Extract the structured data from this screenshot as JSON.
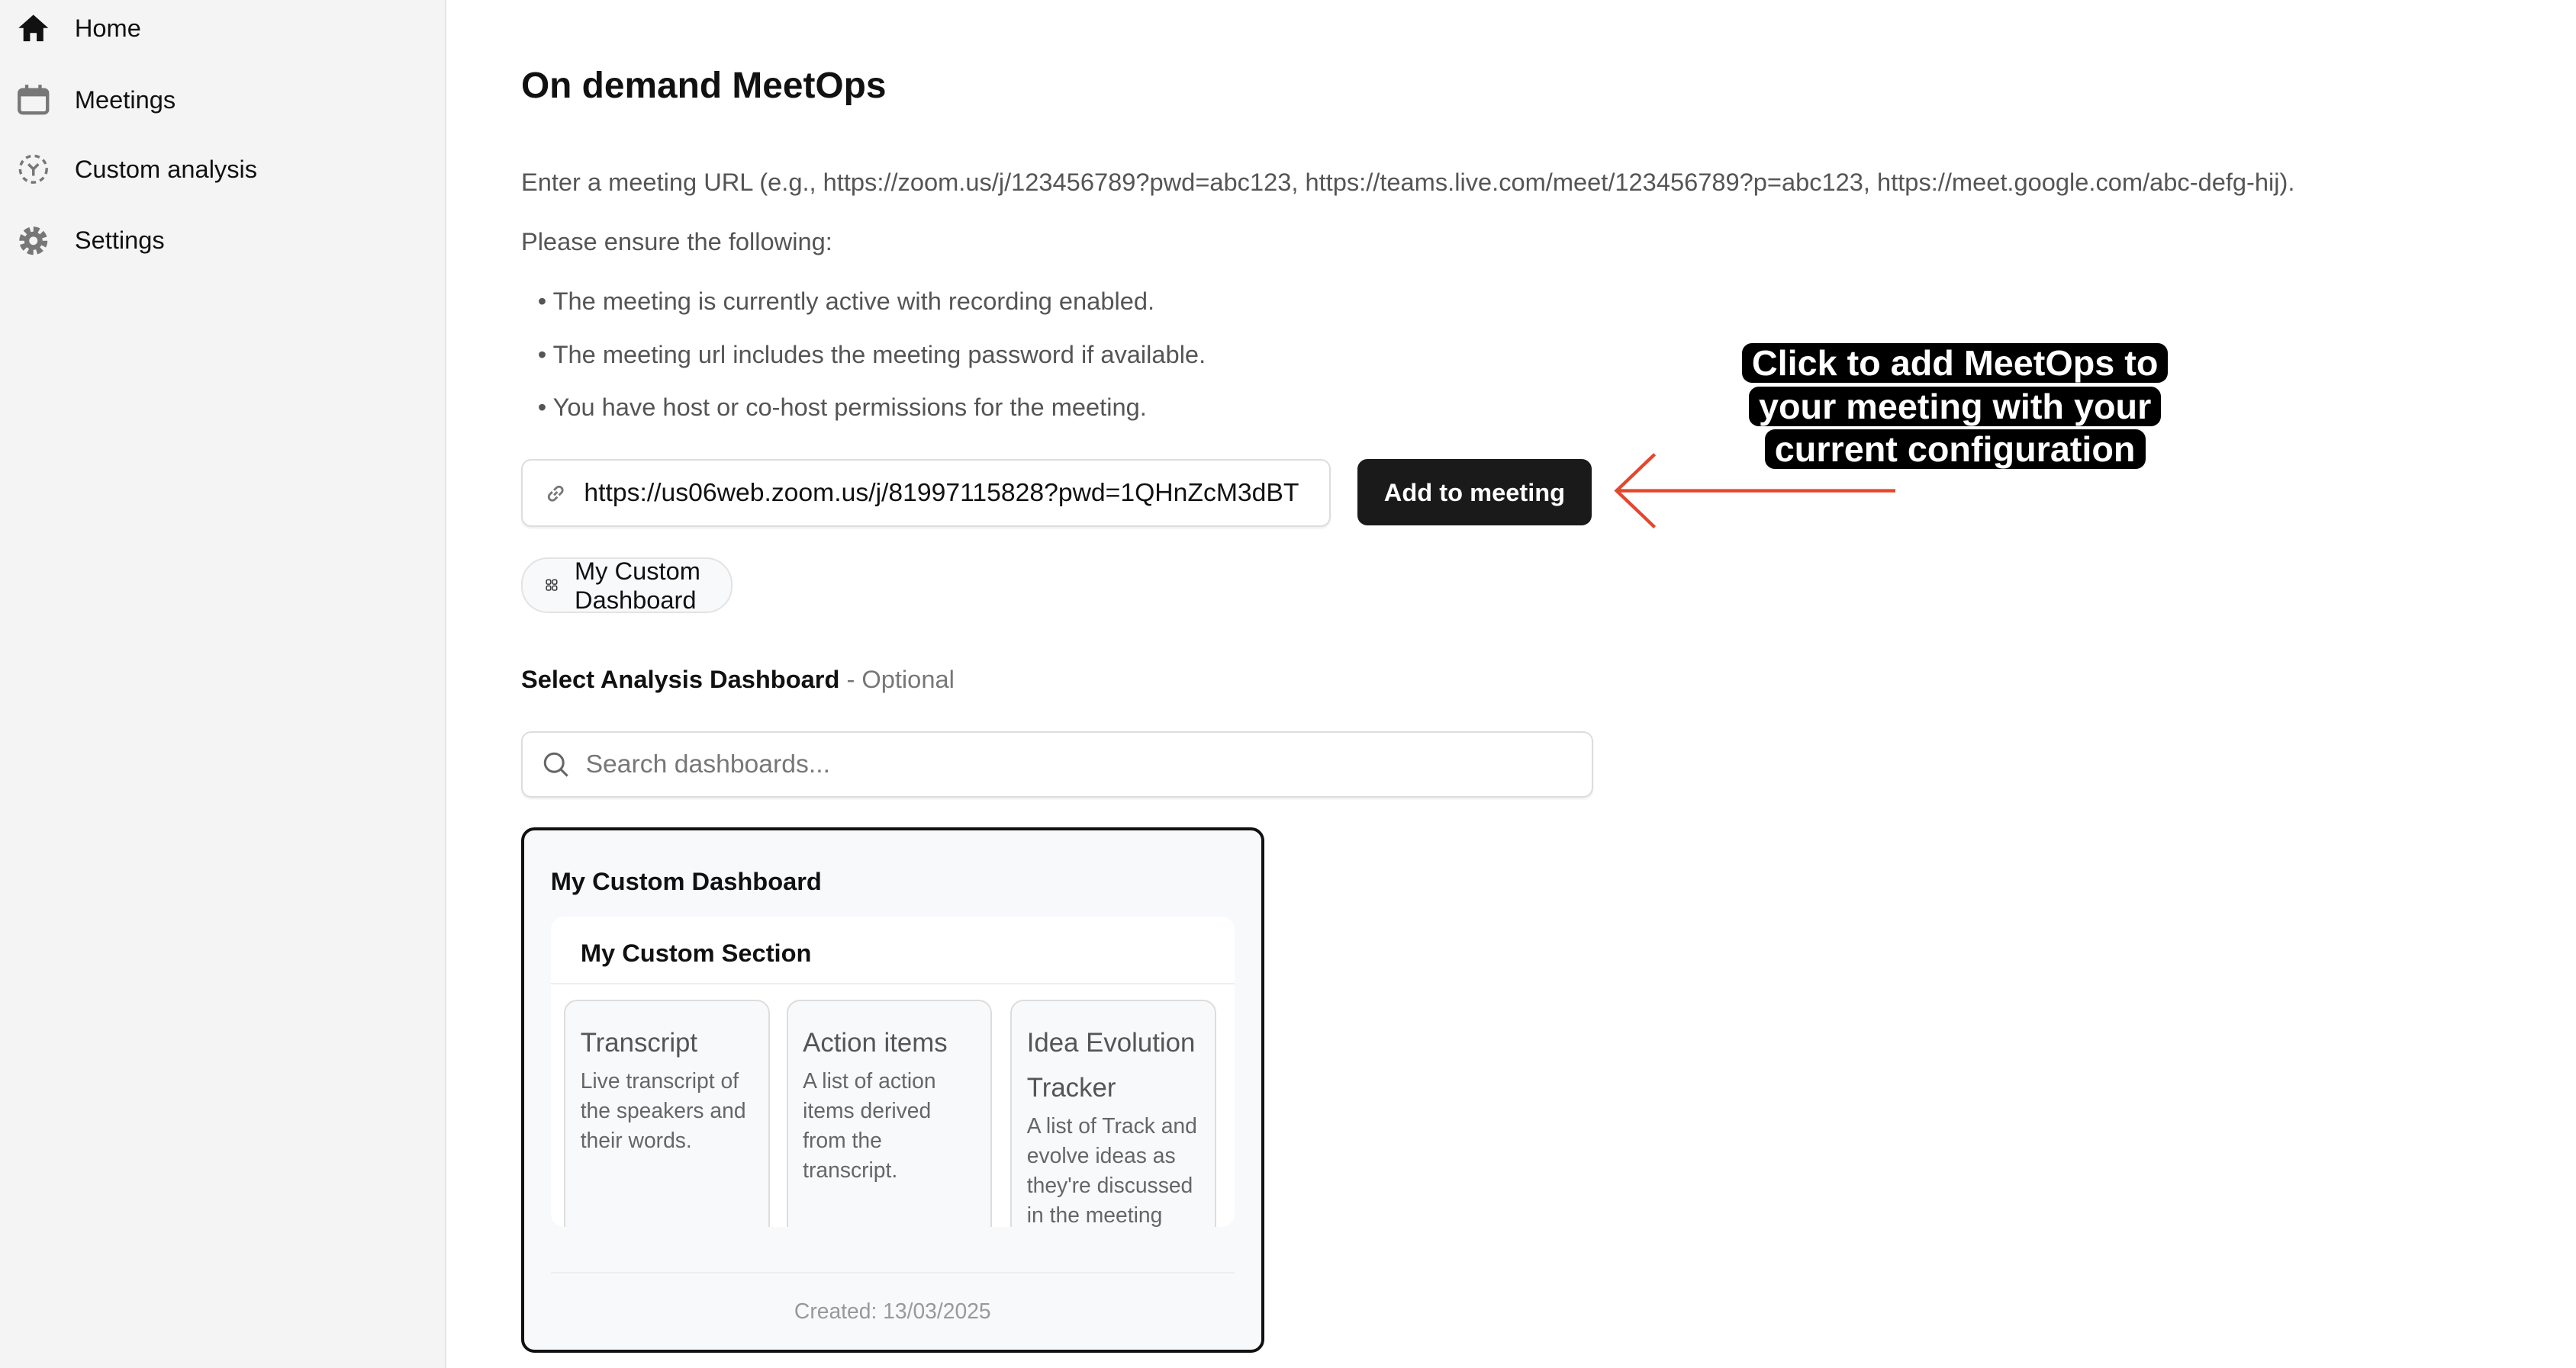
{
  "sidebar": {
    "items": [
      {
        "label": "Home",
        "icon": "home-icon"
      },
      {
        "label": "Meetings",
        "icon": "calendar-icon"
      },
      {
        "label": "Custom analysis",
        "icon": "custom-analysis-icon"
      },
      {
        "label": "Settings",
        "icon": "gear-icon"
      }
    ]
  },
  "main": {
    "title": "On demand MeetOps",
    "description": "Enter a meeting URL (e.g., https://zoom.us/j/123456789?pwd=abc123, https://teams.live.com/meet/123456789?p=abc123, https://meet.google.com/abc-defg-hij).",
    "ensure": "Please ensure the following:",
    "bullets": [
      "The meeting is currently active with recording enabled.",
      "The meeting url includes the meeting password if available.",
      "You have host or co-host permissions for the meeting."
    ],
    "url_value": "https://us06web.zoom.us/j/81997115828?pwd=1QHnZcM3dBT",
    "add_button": "Add to meeting",
    "selected_dashboard_chip": "My Custom Dashboard",
    "select_label": "Select Analysis Dashboard",
    "select_optional": "- Optional",
    "search_placeholder": "Search dashboards...",
    "dashboard_card": {
      "title": "My Custom Dashboard",
      "section_title": "My Custom Section",
      "tiles": [
        {
          "title": "Transcript",
          "desc": "Live transcript of the speakers and their words."
        },
        {
          "title": "Action items",
          "desc": "A list of action items derived from the transcript."
        },
        {
          "title": "Idea Evolution Tracker",
          "desc": "A list of Track and evolve ideas as they're discussed in the meeting"
        }
      ],
      "created": "Created: 13/03/2025"
    }
  },
  "annotation": {
    "text": "Click to add MeetOps to your meeting with your current configuration",
    "arrow_color": "#e4472c"
  }
}
